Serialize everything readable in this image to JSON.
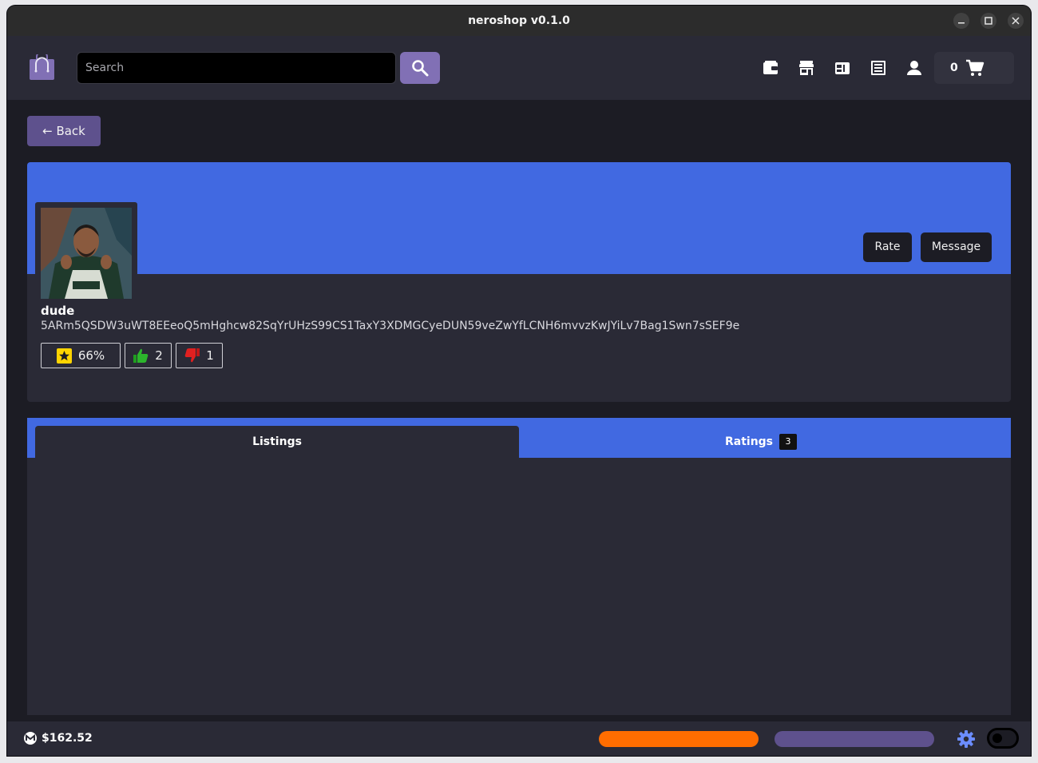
{
  "window": {
    "title": "neroshop v0.1.0"
  },
  "header": {
    "search": {
      "placeholder": "Search",
      "value": ""
    },
    "cart": {
      "count": "0"
    },
    "nav_icons": [
      "wallet-icon",
      "store-icon",
      "inventory-icon",
      "orders-icon",
      "account-icon"
    ]
  },
  "back": {
    "label": "← Back"
  },
  "profile": {
    "name": "dude",
    "address": "5ARm5QSDW3uWT8EEeoQ5mHghcw82SqYrUHzS99CS1TaxY3XDMGCyeDUN59veZwYfLCNH6mvvzKwJYiLv7Bag1Swn7sSEF9e",
    "rate_label": "Rate",
    "message_label": "Message",
    "stats": {
      "reputation": "66%",
      "likes": "2",
      "dislikes": "1"
    }
  },
  "tabs": {
    "listings_label": "Listings",
    "ratings_label": "Ratings",
    "ratings_count": "3"
  },
  "status": {
    "balance": "$162.52"
  },
  "colors": {
    "accent": "#4169e1",
    "brand_purple": "#8170b5",
    "back_purple": "#5e518d",
    "sync_orange": "#ff6d00",
    "panel": "#2a2a36",
    "background": "#1c1c24"
  }
}
